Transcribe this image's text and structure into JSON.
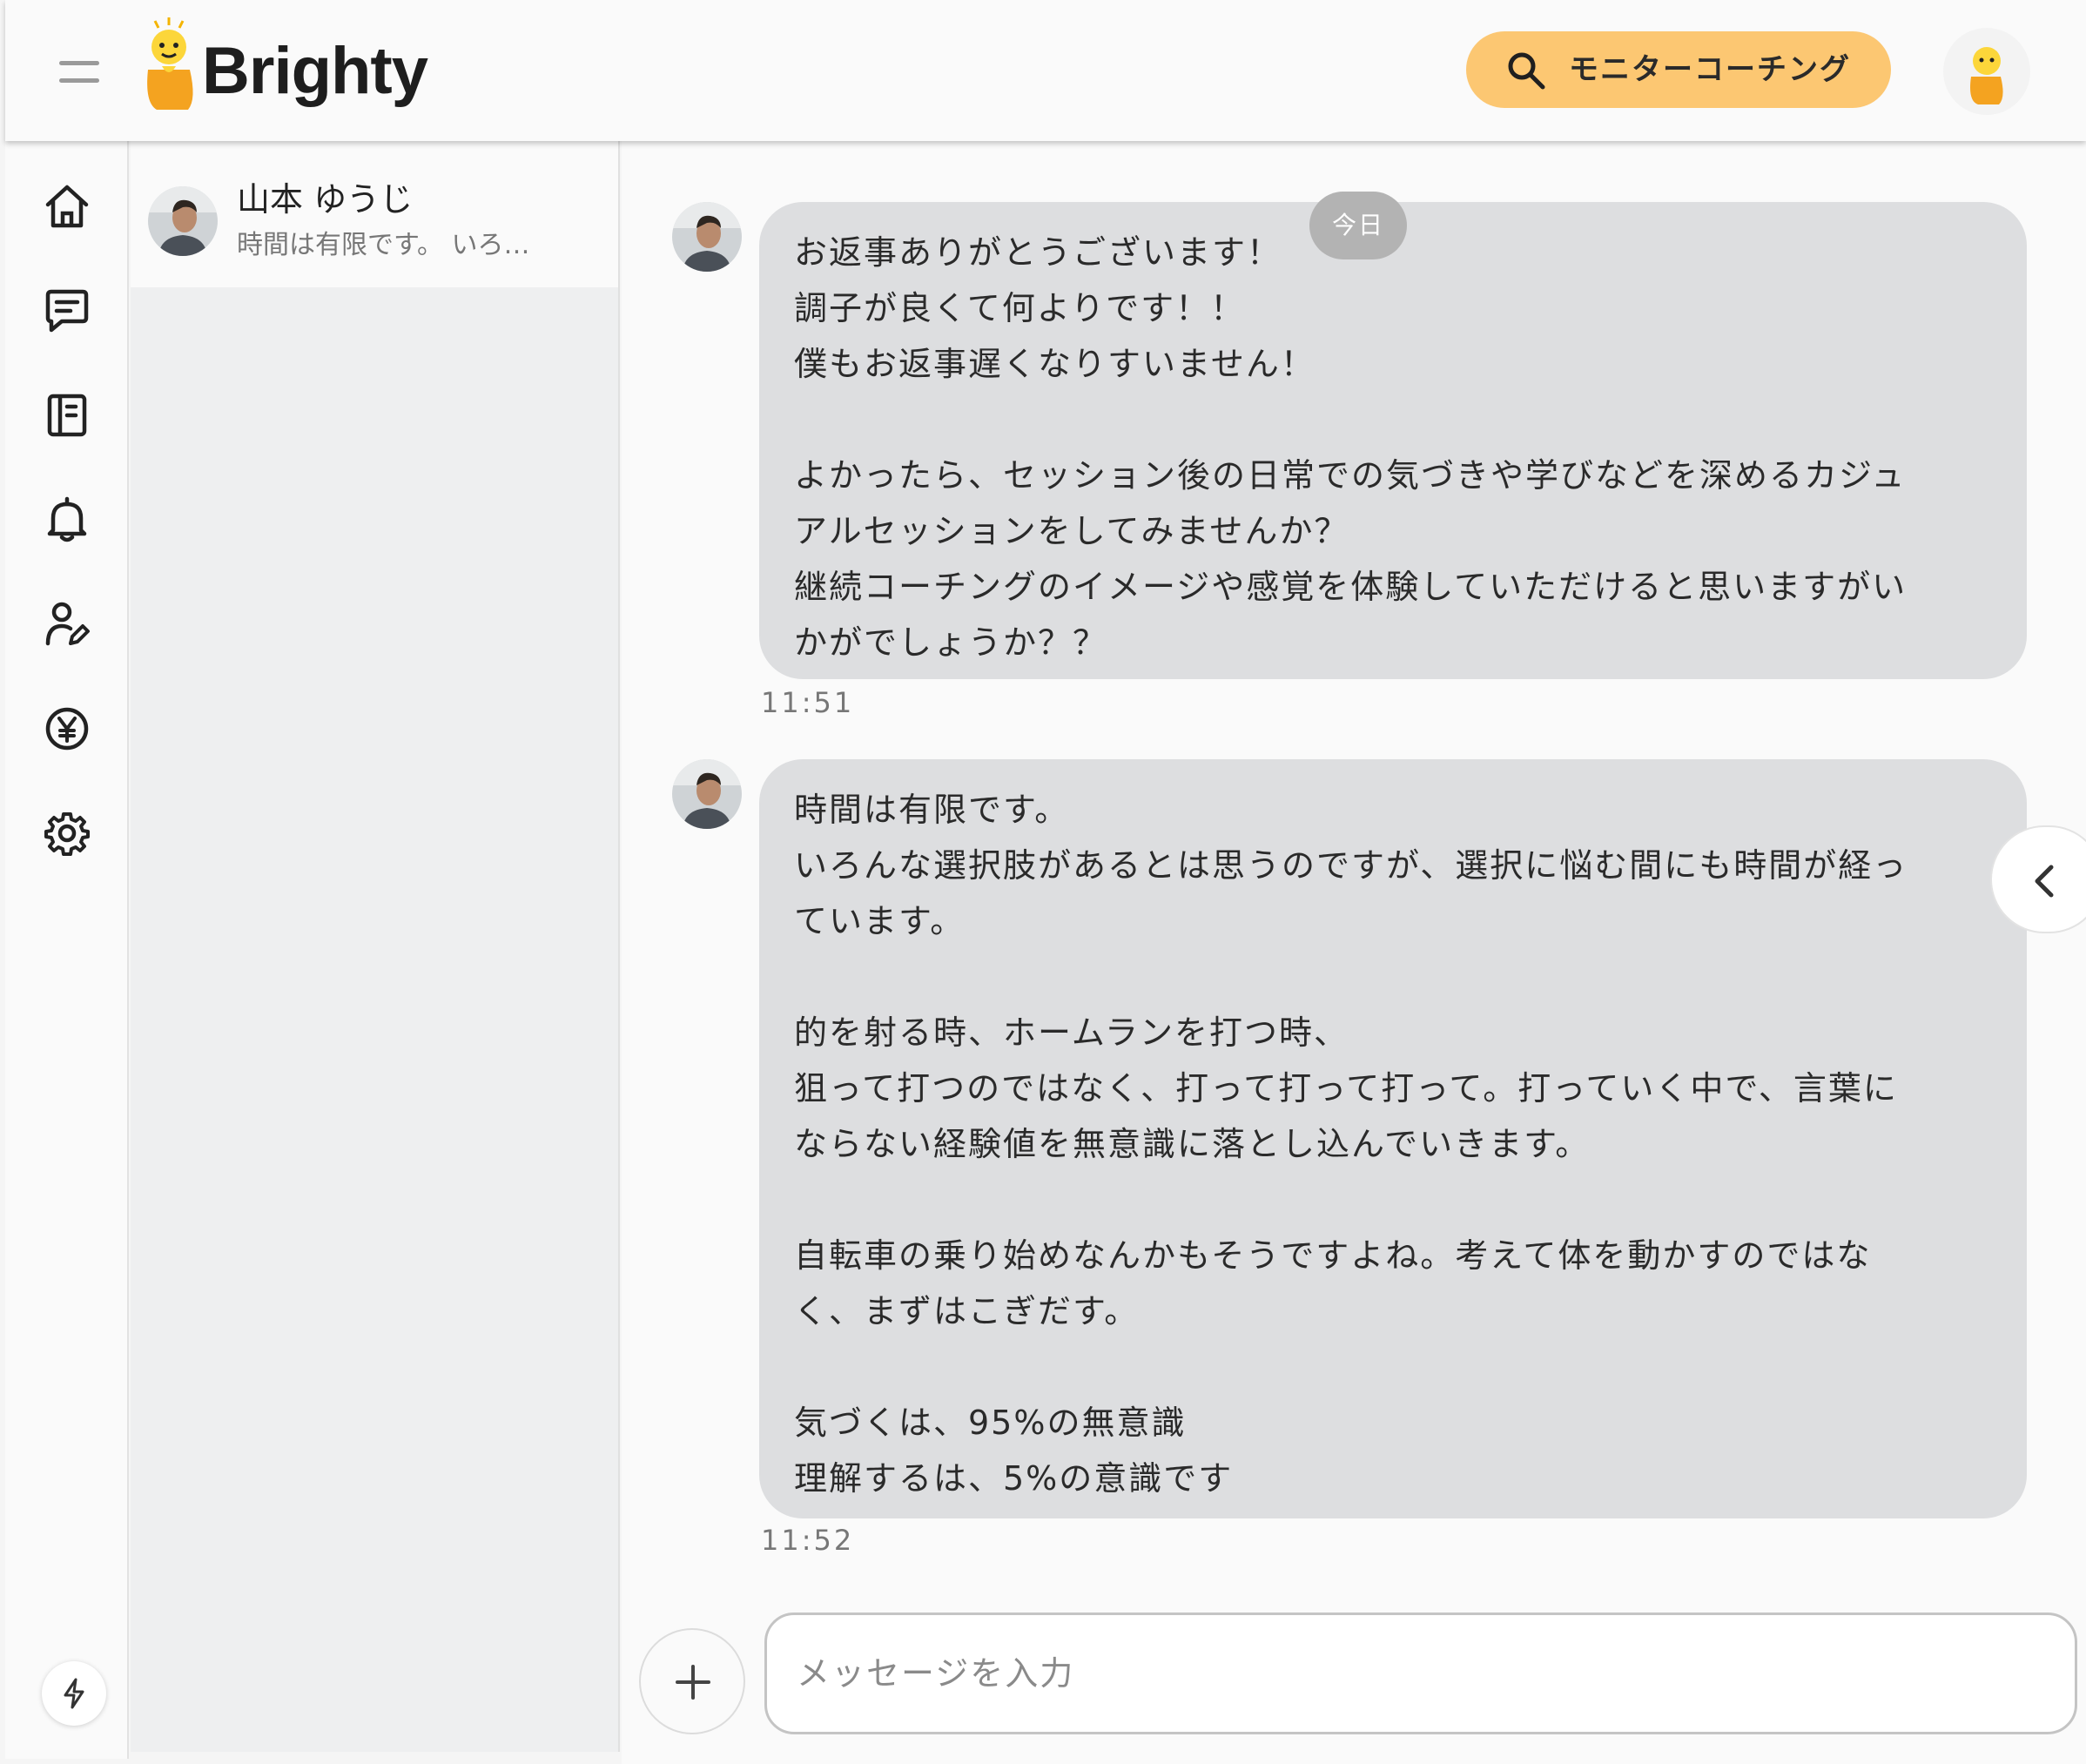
{
  "header": {
    "menu_icon": "hamburger-menu-icon",
    "logo_text": "Brighty",
    "coaching_button_label": "モニターコーチング",
    "coaching_button_icon": "search-icon",
    "brand_color": "#fcc772"
  },
  "sidebar": {
    "items": [
      {
        "name": "home",
        "icon": "home-icon"
      },
      {
        "name": "messages",
        "icon": "chat-icon"
      },
      {
        "name": "notebook",
        "icon": "notebook-icon"
      },
      {
        "name": "notifications",
        "icon": "bell-icon"
      },
      {
        "name": "profile-edit",
        "icon": "user-edit-icon"
      },
      {
        "name": "payments",
        "icon": "yen-icon"
      },
      {
        "name": "settings",
        "icon": "gear-icon"
      }
    ],
    "bottom_icon": "lightning-icon"
  },
  "conversations": [
    {
      "name": "山本 ゆうじ",
      "preview": "時間は有限です。 いろ…"
    }
  ],
  "chat": {
    "date_badge": "今日",
    "messages": [
      {
        "lines": [
          "お返事ありがとうございます！",
          "調子が良くて何よりです！！",
          "僕もお返事遅くなりすいません！",
          "",
          "よかったら、セッション後の日常での気づきや学びなどを深めるカジュ",
          "アルセッションをしてみませんか？",
          "継続コーチングのイメージや感覚を体験していただけると思いますがい",
          "かがでしょうか？？"
        ],
        "time": "11:51"
      },
      {
        "lines": [
          "時間は有限です。",
          "いろんな選択肢があるとは思うのですが、選択に悩む間にも時間が経っ",
          "ています。",
          "",
          "的を射る時、ホームランを打つ時、",
          "狙って打つのではなく、打って打って打って。打っていく中で、言葉に",
          "ならない経験値を無意識に落とし込んでいきます。",
          "",
          "自転車の乗り始めなんかもそうですよね。考えて体を動かすのではな",
          "く、まずはこぎだす。",
          "",
          "気づくは、95%の無意識",
          "理解するは、5%の意識です"
        ],
        "time": "11:52"
      }
    ],
    "input_placeholder": "メッセージを入力",
    "add_icon": "plus-icon",
    "collapse_icon": "chevron-left-icon"
  }
}
